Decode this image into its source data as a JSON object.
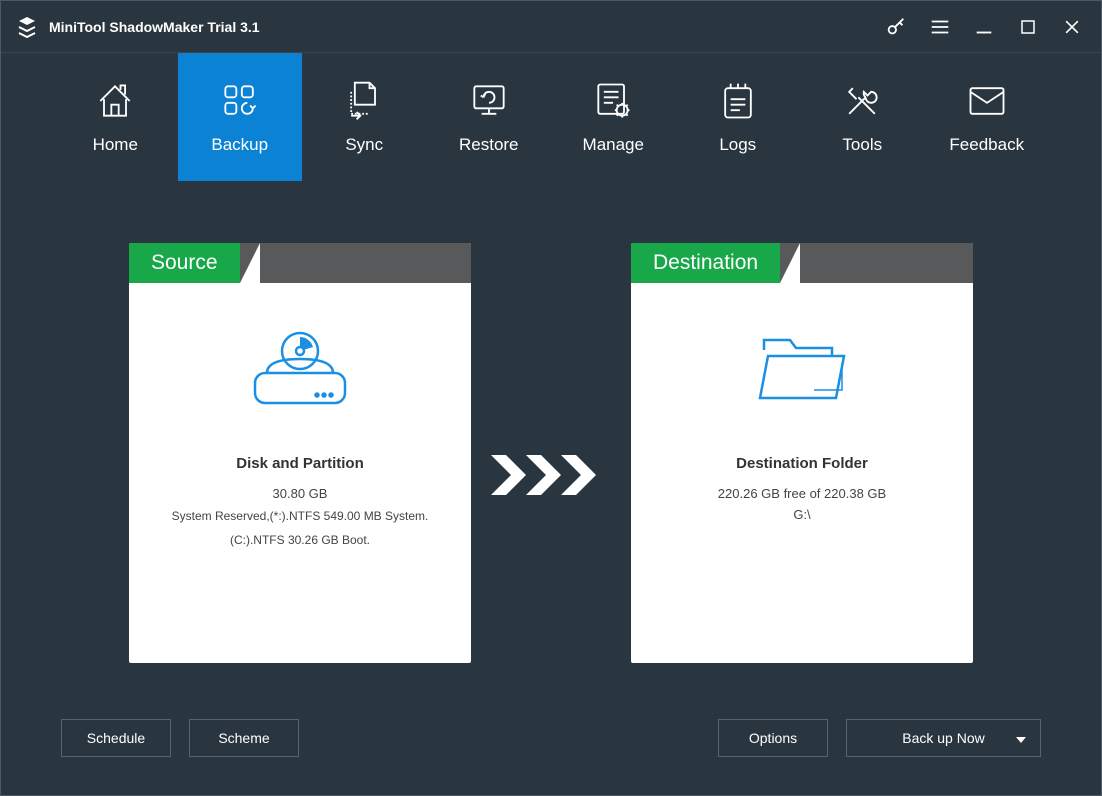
{
  "titlebar": {
    "title": "MiniTool ShadowMaker Trial 3.1"
  },
  "nav": {
    "items": [
      {
        "label": "Home"
      },
      {
        "label": "Backup"
      },
      {
        "label": "Sync"
      },
      {
        "label": "Restore"
      },
      {
        "label": "Manage"
      },
      {
        "label": "Logs"
      },
      {
        "label": "Tools"
      },
      {
        "label": "Feedback"
      }
    ]
  },
  "source": {
    "tab": "Source",
    "title": "Disk and Partition",
    "size": "30.80 GB",
    "detail1": "System Reserved,(*:).NTFS 549.00 MB System.",
    "detail2": "(C:).NTFS 30.26 GB Boot."
  },
  "destination": {
    "tab": "Destination",
    "title": "Destination Folder",
    "free": "220.26 GB free of 220.38 GB",
    "path": "G:\\"
  },
  "buttons": {
    "schedule": "Schedule",
    "scheme": "Scheme",
    "options": "Options",
    "backupNow": "Back up Now"
  }
}
